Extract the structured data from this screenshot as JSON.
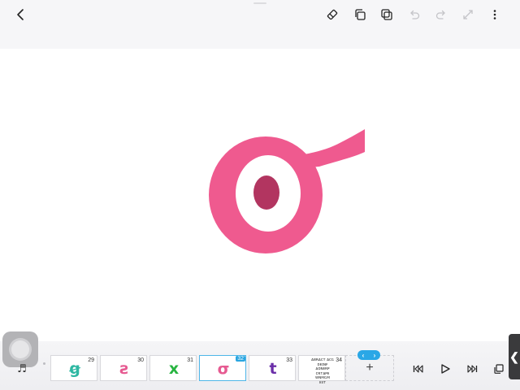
{
  "toolbar": {
    "icons": [
      "back-chevron-icon",
      "eraser-icon",
      "copy-frame-icon",
      "paste-frame-icon",
      "undo-icon",
      "redo-icon",
      "transform-icon",
      "more-options-icon"
    ]
  },
  "canvas": {
    "current_glyph": "σ",
    "glyph_color": "#ef5a8f",
    "glyph_dot_color": "#b23560"
  },
  "timeline": {
    "frames": [
      {
        "number": "29",
        "glyph": "ꞡ",
        "color": "#2eb7a2"
      },
      {
        "number": "30",
        "glyph": "ƨ",
        "color": "#e65a91"
      },
      {
        "number": "31",
        "glyph": "x",
        "color": "#27b440"
      },
      {
        "number": "32",
        "glyph": "σ",
        "color": "#e65a91",
        "selected": true
      },
      {
        "number": "33",
        "glyph": "t",
        "color": "#6a2ea8"
      },
      {
        "number": "34",
        "text": "ᴀʙʀᴀᴄᴛ ᴀᴄɢ\nᴅᴇɪɴꜰ\nᴀᴏɴᴇʀᴘ\nᴄʀᴛᴀᴘᴇ\nᴡɴᴍɢᴍ\nᴇꜱᴛ",
        "color": "#333333"
      }
    ],
    "add_label": "+",
    "nav_prev": "‹",
    "nav_next": "›",
    "side_tab_label": "❮",
    "accent_color": "#2aa7e6"
  }
}
